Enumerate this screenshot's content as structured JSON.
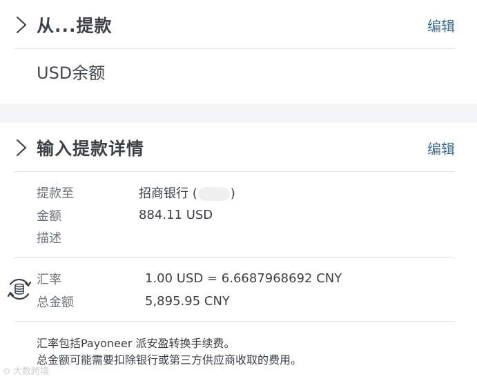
{
  "withdraw_from": {
    "title": "从...提款",
    "edit_label": "编辑",
    "balance_label": "USD余额"
  },
  "withdraw_details": {
    "title": "输入提款详情",
    "edit_label": "编辑",
    "to_label": "提款至",
    "to_value_prefix": "招商银行 (",
    "to_value_suffix": ")",
    "amount_label": "金额",
    "amount_value": "884.11 USD",
    "description_label": "描述",
    "description_value": ""
  },
  "conversion": {
    "rate_label": "汇率",
    "rate_value": "1.00 USD = 6.6687968692 CNY",
    "total_label": "总金额",
    "total_value": "5,895.95 CNY",
    "icon": "currency-exchange-icon"
  },
  "notes": {
    "line1": "汇率包括Payoneer 派安盈转换手续费。",
    "line2": "总金额可能需要扣除银行或第三方供应商收取的费用。"
  },
  "watermark": {
    "text": "大数跨境"
  },
  "colors": {
    "edit_link": "#3b6e8f",
    "page_background": "#f4f5f7",
    "card_background": "#ffffff"
  }
}
